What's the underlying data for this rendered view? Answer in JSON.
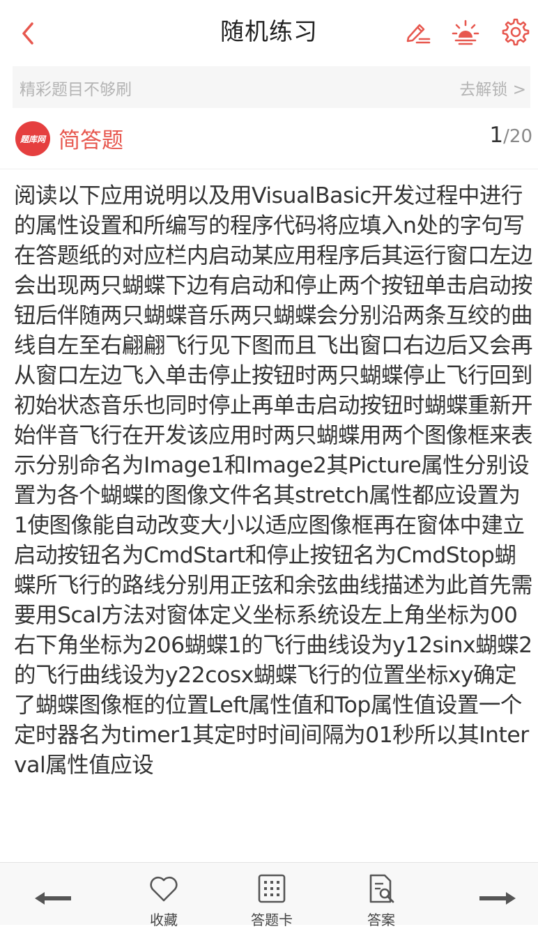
{
  "header": {
    "title": "随机练习"
  },
  "banner": {
    "text": "精彩题目不够刷",
    "link": "去解锁 >"
  },
  "question_meta": {
    "logo_text": "题库网",
    "type": "简答题",
    "current": "1",
    "slash": "/",
    "total": "20"
  },
  "question": {
    "text": "阅读以下应用说明以及用VisualBasic开发过程中进行的属性设置和所编写的程序代码将应填入n处的字句写在答题纸的对应栏内启动某应用程序后其运行窗口左边会出现两只蝴蝶下边有启动和停止两个按钮单击启动按钮后伴随两只蝴蝶音乐两只蝴蝶会分别沿两条互绞的曲线自左至右翩翩飞行见下图而且飞出窗口右边后又会再从窗口左边飞入单击停止按钮时两只蝴蝶停止飞行回到初始状态音乐也同时停止再单击启动按钮时蝴蝶重新开始伴音飞行在开发该应用时两只蝴蝶用两个图像框来表示分别命名为Image1和Image2其Picture属性分别设置为各个蝴蝶的图像文件名其stretch属性都应设置为1使图像能自动改变大小以适应图像框再在窗体中建立启动按钮名为CmdStart和停止按钮名为CmdStop蝴蝶所飞行的路线分别用正弦和余弦曲线描述为此首先需要用Scal方法对窗体定义坐标系统设左上角坐标为00右下角坐标为206蝴蝶1的飞行曲线设为y12sinx蝴蝶2的飞行曲线设为y22cosx蝴蝶飞行的位置坐标xy确定了蝴蝶图像框的位置Left属性值和Top属性值设置一个定时器名为timer1其定时时间间隔为01秒所以其Interval属性值应设"
  },
  "bottom_bar": {
    "favorite_label": "收藏",
    "answer_card_label": "答题卡",
    "answer_label": "答案"
  },
  "colors": {
    "accent": "#e7574e",
    "text": "#333333",
    "muted": "#b4b4b4"
  }
}
